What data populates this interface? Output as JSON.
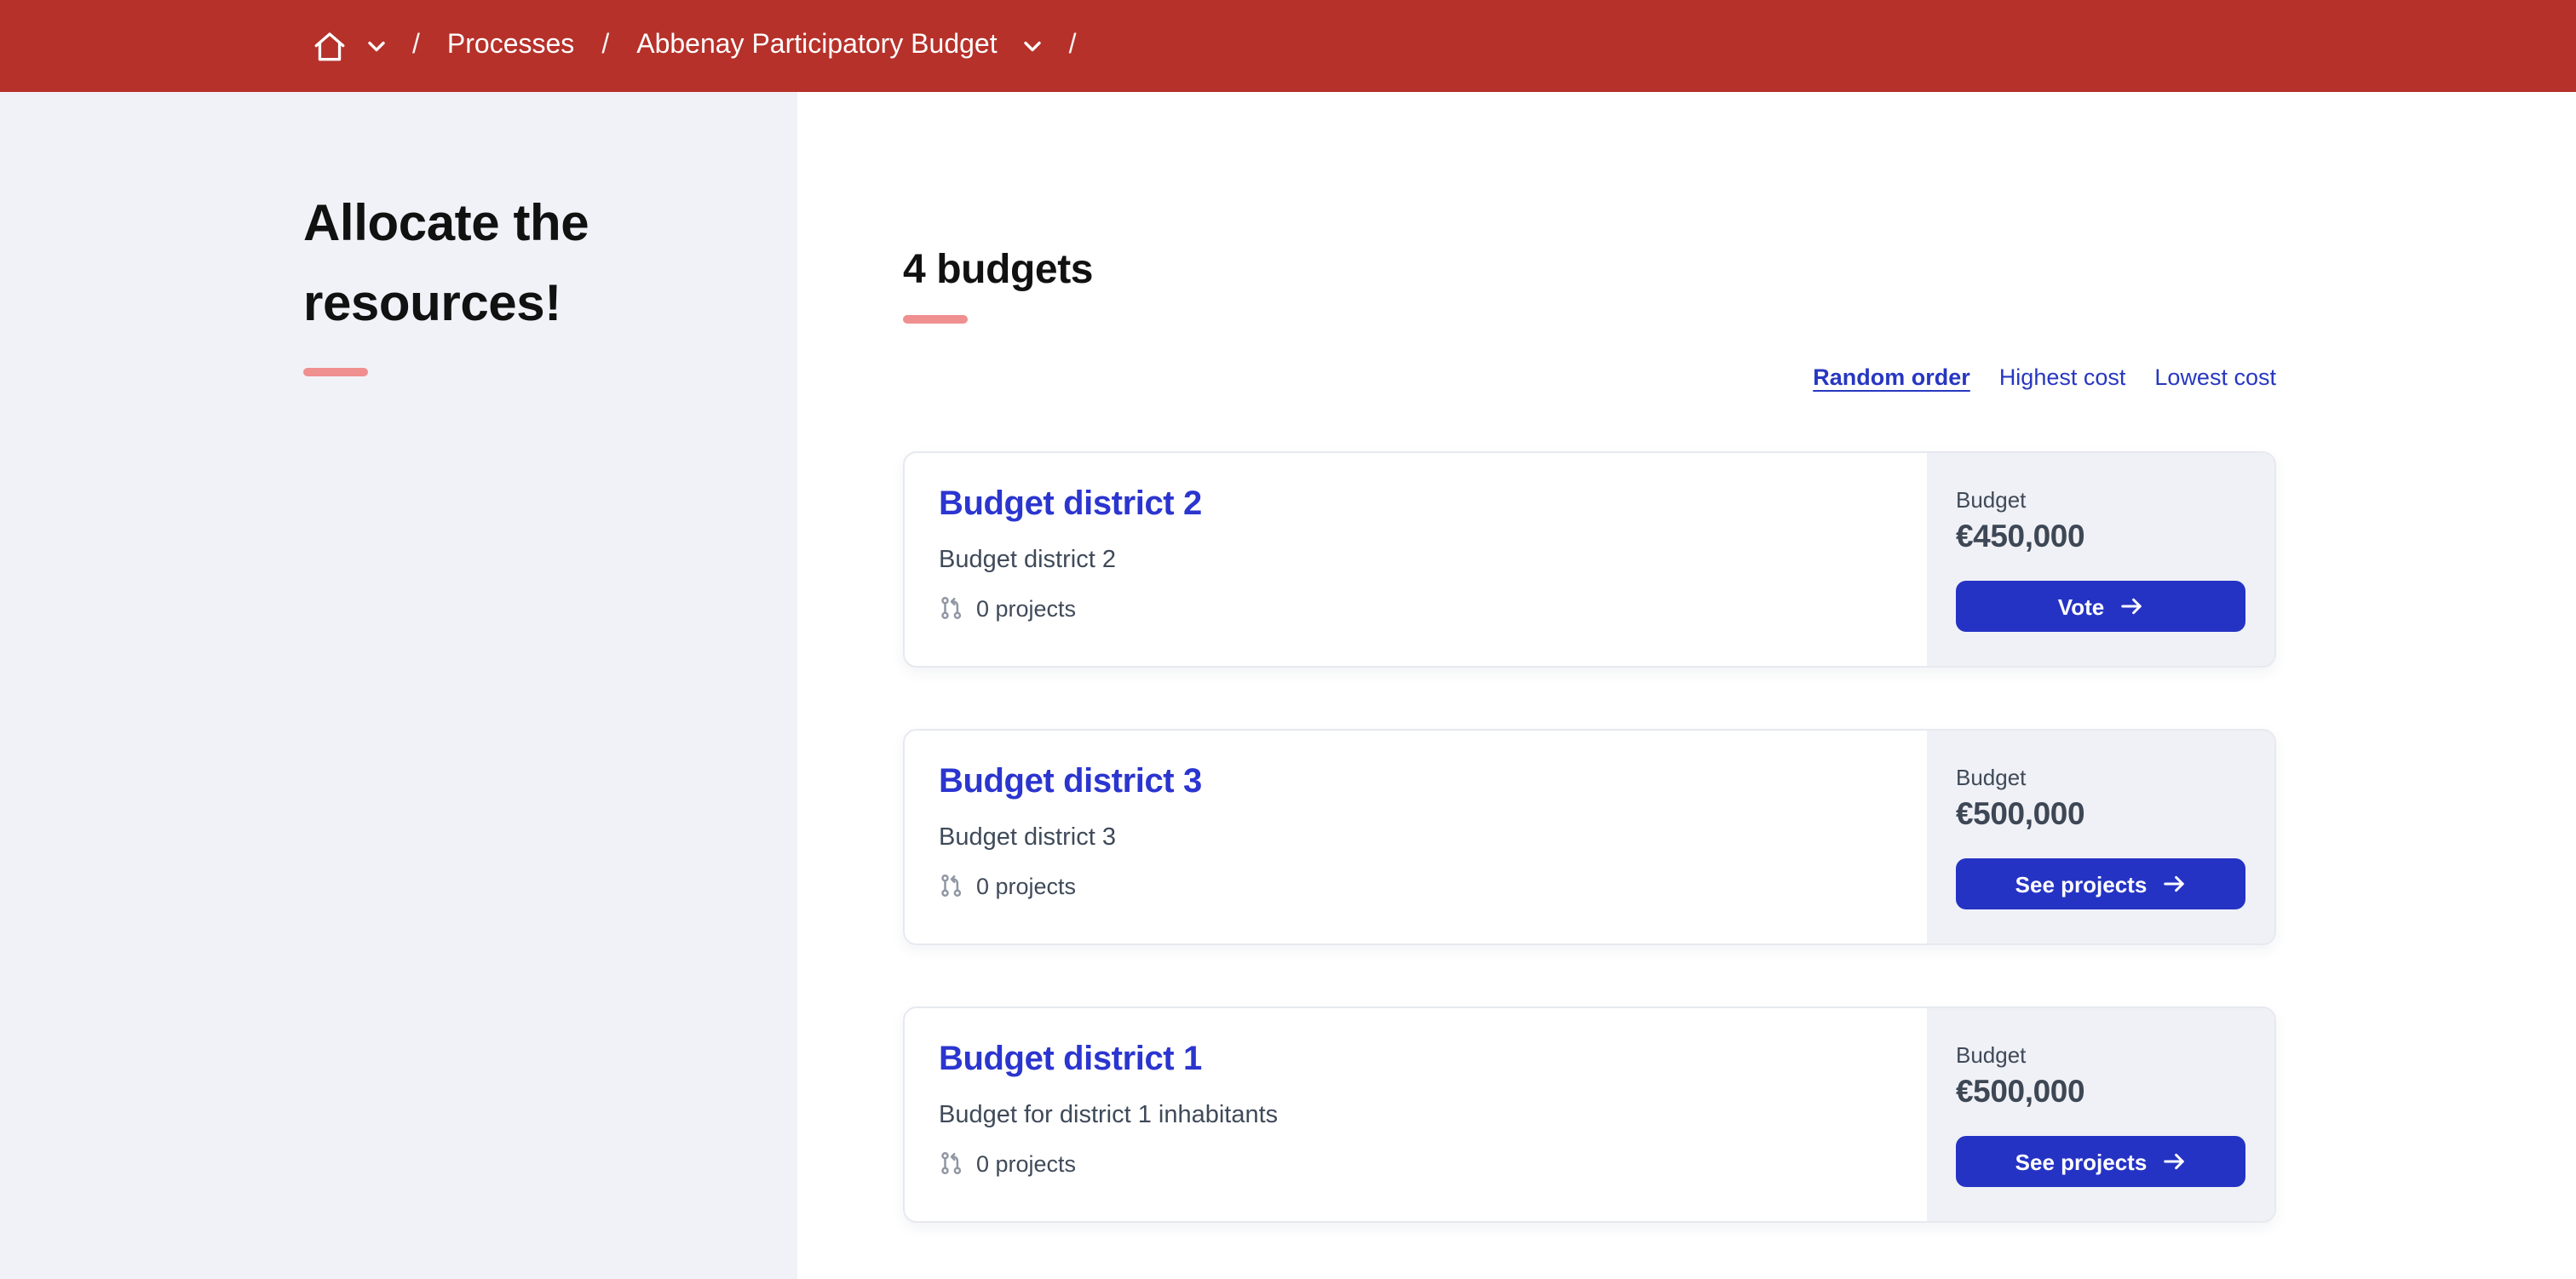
{
  "theme": {
    "topbar_red": "#b5312a",
    "accent_blue": "#2533c4",
    "title_blue": "#2b35cf",
    "link_blue": "#2737c1",
    "underline_salmon": "#ef8f8f",
    "sidebar_bg": "#f1f2f7",
    "panel_bg": "#f0f1f6",
    "card_border": "#e7e9f0",
    "text_dark": "#111111",
    "text_slate": "#3f4a59",
    "amount_color": "#3e4755",
    "icon_gray": "#9097a3"
  },
  "icons": {
    "home": "home-icon",
    "home_dropdown": "chevron-down-icon",
    "process_dropdown": "chevron-down-icon",
    "projects": "git-pull-request-icon",
    "button_arrow": "arrow-right-icon"
  },
  "breadcrumb": {
    "separator": "/",
    "processes_label": "Processes",
    "current_label": "Abbenay Participatory Budget"
  },
  "sidebar": {
    "title": "Allocate the resources!"
  },
  "main": {
    "heading": "4 budgets",
    "sort_options": [
      {
        "label": "Random order",
        "active": true
      },
      {
        "label": "Highest cost",
        "active": false
      },
      {
        "label": "Lowest cost",
        "active": false
      }
    ],
    "cards": [
      {
        "title": "Budget district 2",
        "subtitle": "Budget district 2",
        "projects": "0 projects",
        "budget_label": "Budget",
        "amount": "€450,000",
        "button_label": "Vote"
      },
      {
        "title": "Budget district 3",
        "subtitle": "Budget district 3",
        "projects": "0 projects",
        "budget_label": "Budget",
        "amount": "€500,000",
        "button_label": "See projects"
      },
      {
        "title": "Budget district 1",
        "subtitle": "Budget for district 1 inhabitants",
        "projects": "0 projects",
        "budget_label": "Budget",
        "amount": "€500,000",
        "button_label": "See projects"
      }
    ]
  }
}
